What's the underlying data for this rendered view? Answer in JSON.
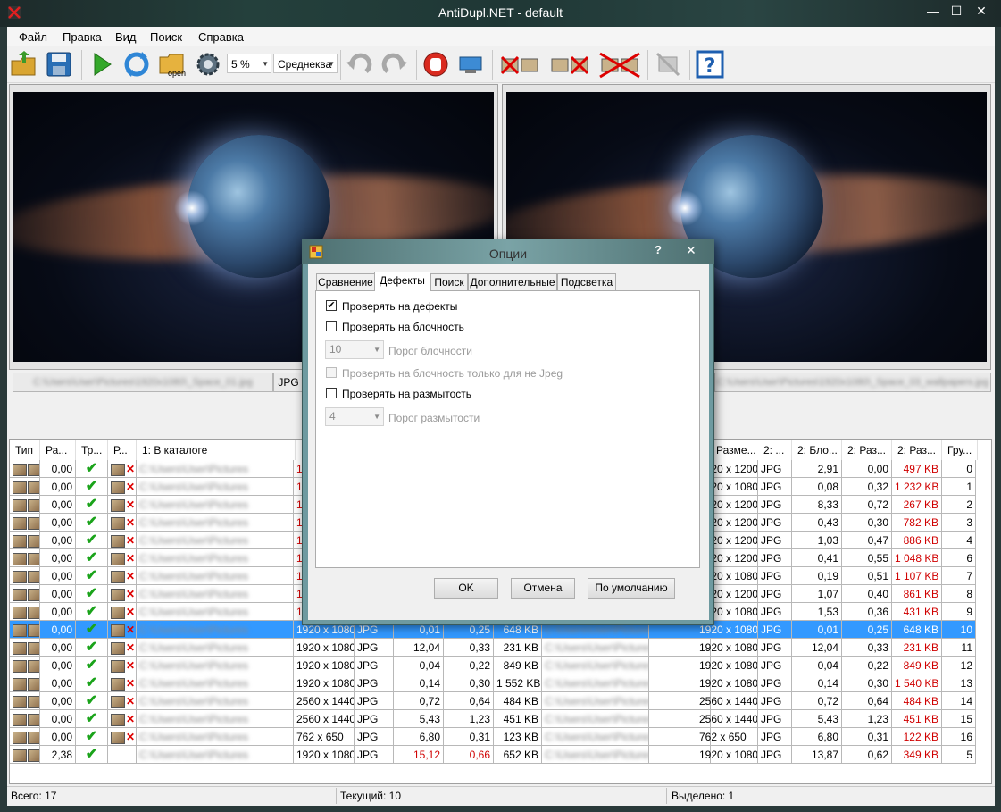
{
  "window": {
    "title": "AntiDupl.NET - default",
    "min": "—",
    "max": "☐",
    "close": "✕"
  },
  "menu": [
    "Файл",
    "Правка",
    "Вид",
    "Поиск",
    "Справка"
  ],
  "toolbar": {
    "threshold": "5 %",
    "algorithm": "Среднеква",
    "open_label": "open",
    "help": "?"
  },
  "panels": {
    "left_format": "JPG",
    "left_path": "C:\\Users\\User\\Pictures\\1920x1080\\_Space_01.jpg",
    "right_path": "C:\\Users\\User\\Pictures\\1920x1080\\_Space_03_wallpapers.jpg"
  },
  "table": {
    "headers_left": [
      "Тип",
      "Ра...",
      "Тр...",
      "Р...",
      "1: В каталоге"
    ],
    "headers_right": [
      "Разме...",
      "2: ...",
      "2: Бло...",
      "2: Раз...",
      "2: Раз...",
      "Гру..."
    ],
    "rows": [
      {
        "size": "1920 x 1200",
        "f": "JPG",
        "b": "2,91",
        "bl": "0,00",
        "kb": "497 KB",
        "g": "0",
        "l": "1",
        "lres": "",
        "lb": "",
        "lbl": "",
        "lkb": ""
      },
      {
        "size": "1920 x 1080",
        "f": "JPG",
        "b": "0,08",
        "bl": "0,32",
        "kb": "1 232 KB",
        "g": "1",
        "l": "1",
        "lres": "",
        "lb": "",
        "lbl": "",
        "lkb": ""
      },
      {
        "size": "1920 x 1200",
        "f": "JPG",
        "b": "8,33",
        "bl": "0,72",
        "kb": "267 KB",
        "g": "2",
        "l": "1",
        "lres": "",
        "lb": "",
        "lbl": "",
        "lkb": ""
      },
      {
        "size": "1920 x 1200",
        "f": "JPG",
        "b": "0,43",
        "bl": "0,30",
        "kb": "782 KB",
        "g": "3",
        "l": "1",
        "lres": "",
        "lb": "",
        "lbl": "",
        "lkb": ""
      },
      {
        "size": "1920 x 1200",
        "f": "JPG",
        "b": "1,03",
        "bl": "0,47",
        "kb": "886 KB",
        "g": "4",
        "l": "1",
        "lres": "",
        "lb": "",
        "lbl": "",
        "lkb": ""
      },
      {
        "size": "1920 x 1200",
        "f": "JPG",
        "b": "0,41",
        "bl": "0,55",
        "kb": "1 048 KB",
        "g": "6",
        "l": "1",
        "lres": "",
        "lb": "",
        "lbl": "",
        "lkb": ""
      },
      {
        "size": "1920 x 1080",
        "f": "JPG",
        "b": "0,19",
        "bl": "0,51",
        "kb": "1 107 KB",
        "g": "7",
        "l": "1",
        "lres": "",
        "lb": "",
        "lbl": "",
        "lkb": ""
      },
      {
        "size": "1920 x 1200",
        "f": "JPG",
        "b": "1,07",
        "bl": "0,40",
        "kb": "861 KB",
        "g": "8",
        "l": "1",
        "lres": "",
        "lb": "",
        "lbl": "",
        "lkb": ""
      },
      {
        "size": "1920 x 1080",
        "f": "JPG",
        "b": "1,53",
        "bl": "0,36",
        "kb": "431 KB",
        "g": "9",
        "l": "1",
        "lres": "",
        "lb": "",
        "lbl": "",
        "lkb": ""
      },
      {
        "size": "1920 x 1080",
        "f": "JPG",
        "b": "0,01",
        "bl": "0,25",
        "kb": "648 KB",
        "g": "10",
        "l": "",
        "lres": "1920 x 1080",
        "lb": "0,01",
        "lbl": "0,25",
        "lkb": "648 KB",
        "sel": true
      },
      {
        "size": "1920 x 1080",
        "f": "JPG",
        "b": "12,04",
        "bl": "0,33",
        "kb": "231 KB",
        "g": "11",
        "l": "",
        "lres": "1920 x 1080",
        "lb": "12,04",
        "lbl": "0,33",
        "lkb": "231 KB"
      },
      {
        "size": "1920 x 1080",
        "f": "JPG",
        "b": "0,04",
        "bl": "0,22",
        "kb": "849 KB",
        "g": "12",
        "l": "",
        "lres": "1920 x 1080",
        "lb": "0,04",
        "lbl": "0,22",
        "lkb": "849 KB"
      },
      {
        "size": "1920 x 1080",
        "f": "JPG",
        "b": "0,14",
        "bl": "0,30",
        "kb": "1 540 KB",
        "g": "13",
        "l": "",
        "lres": "1920 x 1080",
        "lb": "0,14",
        "lbl": "0,30",
        "lkb": "1 552 KB"
      },
      {
        "size": "2560 x 1440",
        "f": "JPG",
        "b": "0,72",
        "bl": "0,64",
        "kb": "484 KB",
        "g": "14",
        "l": "",
        "lres": "2560 x 1440",
        "lb": "0,72",
        "lbl": "0,64",
        "lkb": "484 KB"
      },
      {
        "size": "2560 x 1440",
        "f": "JPG",
        "b": "5,43",
        "bl": "1,23",
        "kb": "451 KB",
        "g": "15",
        "l": "",
        "lres": "2560 x 1440",
        "lb": "5,43",
        "lbl": "1,23",
        "lkb": "451 KB"
      },
      {
        "size": "762 x 650",
        "f": "JPG",
        "b": "6,80",
        "bl": "0,31",
        "kb": "122 KB",
        "g": "16",
        "l": "",
        "lres": "762 x 650",
        "lb": "6,80",
        "lbl": "0,31",
        "lkb": "123 KB"
      },
      {
        "size": "1920 x 1080",
        "f": "JPG",
        "b": "13,87",
        "bl": "0,62",
        "kb": "349 KB",
        "g": "5",
        "l": "",
        "lres": "1920 x 1080",
        "lb": "15,12",
        "lbl": "0,66",
        "lkb": "652 KB",
        "diff": "2,38"
      }
    ],
    "diff_default": "0,00",
    "blur_path": "C:\\Users\\User\\Pictures"
  },
  "status": {
    "total": "Всего: 17",
    "current": "Текущий: 10",
    "selected": "Выделено: 1"
  },
  "dialog": {
    "title": "Опции",
    "help": "?",
    "close": "✕",
    "tabs": [
      "Сравнение",
      "Дефекты",
      "Поиск",
      "Дополнительные",
      "Подсветка"
    ],
    "check_defects": "Проверять на дефекты",
    "check_blockiness": "Проверять на блочность",
    "block_value": "10",
    "block_threshold": "Порог блочности",
    "check_block_nonjpeg": "Проверять на блочность только для не Jpeg",
    "check_blur": "Проверять на размытость",
    "blur_value": "4",
    "blur_threshold": "Порог размытости",
    "ok": "OK",
    "cancel": "Отмена",
    "default": "По умолчанию"
  }
}
